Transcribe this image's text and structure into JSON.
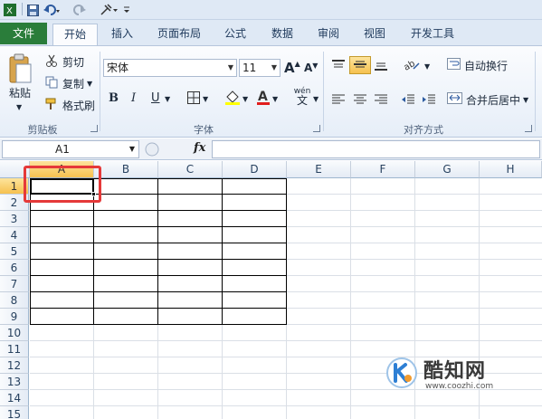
{
  "qat": {
    "save_icon": "save-icon",
    "undo_icon": "undo-icon",
    "redo_icon": "redo-icon",
    "customize_icon": "customize-icon"
  },
  "tabs": {
    "file": "文件",
    "items": [
      "开始",
      "插入",
      "页面布局",
      "公式",
      "数据",
      "审阅",
      "视图",
      "开发工具"
    ]
  },
  "ribbon": {
    "clipboard": {
      "paste": "粘贴",
      "cut": "剪切",
      "copy": "复制",
      "format_painter": "格式刷",
      "label": "剪贴板"
    },
    "font": {
      "name": "宋体",
      "size": "11",
      "bold": "B",
      "italic": "I",
      "underline": "U",
      "grow": "A",
      "shrink": "A",
      "wen": "wén",
      "label": "字体"
    },
    "alignment": {
      "wrap": "自动换行",
      "merge": "合并后居中",
      "label": "对齐方式"
    }
  },
  "formula_bar": {
    "cell_ref": "A1",
    "fx": "fx",
    "value": ""
  },
  "grid": {
    "columns": [
      "A",
      "B",
      "C",
      "D",
      "E",
      "F",
      "G",
      "H"
    ],
    "rows": [
      "1",
      "2",
      "3",
      "4",
      "5",
      "6",
      "7",
      "8",
      "9",
      "10",
      "11",
      "12",
      "13",
      "14",
      "15"
    ],
    "selected_cell": "A1"
  },
  "watermark": {
    "brand": "酷知网",
    "url": "www.coozhi.com"
  },
  "colors": {
    "file_tab": "#2a7d3a",
    "highlight": "#e53939",
    "header_selected": "#f6c14f"
  }
}
